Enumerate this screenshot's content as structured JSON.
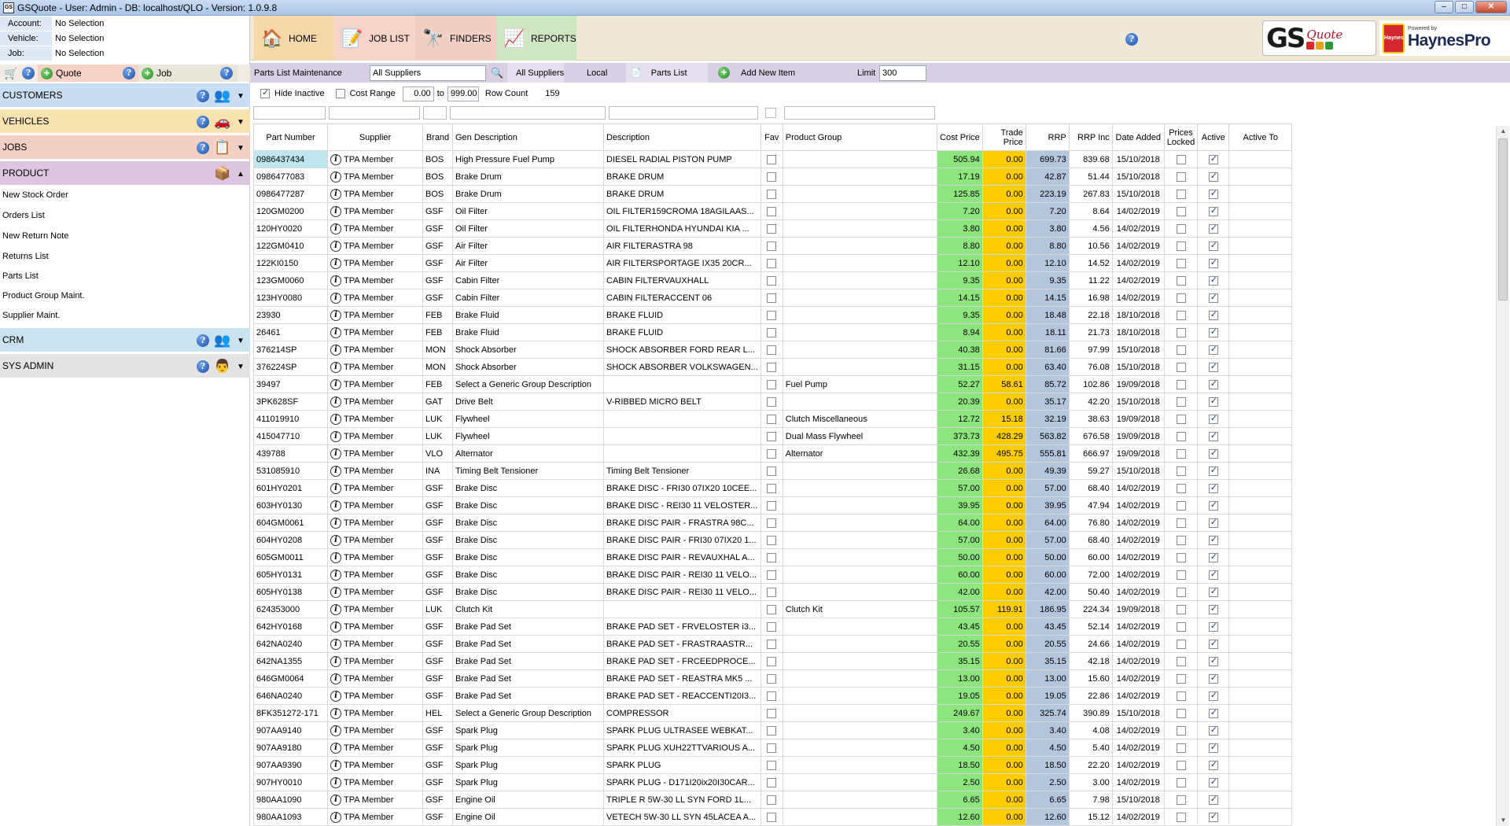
{
  "window": {
    "title": "GSQuote - User: Admin - DB: localhost/QLO - Version: 1.0.9.8",
    "app_icon": "GS"
  },
  "context": [
    {
      "label": "Account:",
      "value": "No Selection"
    },
    {
      "label": "Vehicle:",
      "value": "No Selection"
    },
    {
      "label": "Job:",
      "value": "No Selection"
    }
  ],
  "quickbar": {
    "quote_label": "Quote",
    "job_label": "Job"
  },
  "sections": {
    "customers": "CUSTOMERS",
    "vehicles": "VEHICLES",
    "jobs": "JOBS",
    "product": "PRODUCT",
    "crm": "CRM",
    "sysadmin": "SYS ADMIN"
  },
  "product_menu": [
    "New Stock Order",
    "Orders List",
    "New Return Note",
    "Returns List",
    "Parts List",
    "Product Group Maint.",
    "Supplier Maint."
  ],
  "nav": {
    "home": "HOME",
    "job_list": "JOB LIST",
    "finders": "FINDERS",
    "reports": "REPORTS"
  },
  "logos": {
    "gs": "GS",
    "quote": "Quote",
    "powered_by": "Powered by",
    "haynespro": "HaynesPro",
    "haynes_badge": "Haynes"
  },
  "toolbar": {
    "title": "Parts List Maintenance",
    "supplier_select": "All Suppliers",
    "all_suppliers": "All Suppliers",
    "local": "Local",
    "parts_list": "Parts List",
    "add_new_item": "Add New Item",
    "limit_label": "Limit",
    "limit_value": "300"
  },
  "filters": {
    "hide_inactive_label": "Hide Inactive",
    "hide_inactive_checked": true,
    "cost_range_label": "Cost Range",
    "cost_min": "0.00",
    "to_label": "to",
    "cost_max": "999.00",
    "row_count_label": "Row Count",
    "row_count": "159"
  },
  "columns": [
    "Part Number",
    "Supplier",
    "Brand",
    "Gen Description",
    "Description",
    "Fav",
    "Product Group",
    "Cost Price",
    "Trade Price",
    "RRP",
    "RRP Inc",
    "Date Added",
    "Prices Locked",
    "Active",
    "Active To"
  ],
  "rows": [
    [
      "0986437434",
      "TPA Member",
      "BOS",
      "High Pressure Fuel Pump",
      "DIESEL RADIAL PISTON PUMP",
      "",
      "505.94",
      "0.00",
      "699.73",
      "839.68",
      "15/10/2018"
    ],
    [
      "0986477083",
      "TPA Member",
      "BOS",
      "Brake Drum",
      "BRAKE DRUM",
      "",
      "17.19",
      "0.00",
      "42.87",
      "51.44",
      "15/10/2018"
    ],
    [
      "0986477287",
      "TPA Member",
      "BOS",
      "Brake Drum",
      "BRAKE DRUM",
      "",
      "125.85",
      "0.00",
      "223.19",
      "267.83",
      "15/10/2018"
    ],
    [
      "120GM0200",
      "TPA Member",
      "GSF",
      "Oil Filter",
      "OIL FILTER159CROMA 18AGILAAS...",
      "",
      "7.20",
      "0.00",
      "7.20",
      "8.64",
      "14/02/2019"
    ],
    [
      "120HY0020",
      "TPA Member",
      "GSF",
      "Oil Filter",
      "OIL FILTERHONDA HYUNDAI KIA ...",
      "",
      "3.80",
      "0.00",
      "3.80",
      "4.56",
      "14/02/2019"
    ],
    [
      "122GM0410",
      "TPA Member",
      "GSF",
      "Air Filter",
      "AIR FILTERASTRA 98",
      "",
      "8.80",
      "0.00",
      "8.80",
      "10.56",
      "14/02/2019"
    ],
    [
      "122KI0150",
      "TPA Member",
      "GSF",
      "Air Filter",
      "AIR FILTERSPORTAGE IX35 20CR...",
      "",
      "12.10",
      "0.00",
      "12.10",
      "14.52",
      "14/02/2019"
    ],
    [
      "123GM0060",
      "TPA Member",
      "GSF",
      "Cabin Filter",
      "CABIN FILTERVAUXHALL",
      "",
      "9.35",
      "0.00",
      "9.35",
      "11.22",
      "14/02/2019"
    ],
    [
      "123HY0080",
      "TPA Member",
      "GSF",
      "Cabin Filter",
      "CABIN FILTERACCENT 06",
      "",
      "14.15",
      "0.00",
      "14.15",
      "16.98",
      "14/02/2019"
    ],
    [
      "23930",
      "TPA Member",
      "FEB",
      "Brake Fluid",
      "BRAKE FLUID",
      "",
      "9.35",
      "0.00",
      "18.48",
      "22.18",
      "18/10/2018"
    ],
    [
      "26461",
      "TPA Member",
      "FEB",
      "Brake Fluid",
      "BRAKE FLUID",
      "",
      "8.94",
      "0.00",
      "18.11",
      "21.73",
      "18/10/2018"
    ],
    [
      "376214SP",
      "TPA Member",
      "MON",
      "Shock Absorber",
      "SHOCK ABSORBER FORD REAR  L...",
      "",
      "40.38",
      "0.00",
      "81.66",
      "97.99",
      "15/10/2018"
    ],
    [
      "376224SP",
      "TPA Member",
      "MON",
      "Shock Absorber",
      "SHOCK ABSORBER VOLKSWAGEN...",
      "",
      "31.15",
      "0.00",
      "63.40",
      "76.08",
      "15/10/2018"
    ],
    [
      "39497",
      "TPA Member",
      "FEB",
      "Select a Generic Group Description",
      "",
      "Fuel Pump",
      "52.27",
      "58.61",
      "85.72",
      "102.86",
      "19/09/2018"
    ],
    [
      "3PK628SF",
      "TPA Member",
      "GAT",
      "Drive Belt",
      "V-RIBBED MICRO BELT",
      "",
      "20.39",
      "0.00",
      "35.17",
      "42.20",
      "15/10/2018"
    ],
    [
      "411019910",
      "TPA Member",
      "LUK",
      "Flywheel",
      "",
      "Clutch Miscellaneous",
      "12.72",
      "15.18",
      "32.19",
      "38.63",
      "19/09/2018"
    ],
    [
      "415047710",
      "TPA Member",
      "LUK",
      "Flywheel",
      "",
      "Dual Mass Flywheel",
      "373.73",
      "428.29",
      "563.82",
      "676.58",
      "19/09/2018"
    ],
    [
      "439788",
      "TPA Member",
      "VLO",
      "Alternator",
      "",
      "Alternator",
      "432.39",
      "495.75",
      "555.81",
      "666.97",
      "19/09/2018"
    ],
    [
      "531085910",
      "TPA Member",
      "INA",
      "Timing Belt Tensioner",
      "Timing Belt Tensioner",
      "",
      "26.68",
      "0.00",
      "49.39",
      "59.27",
      "15/10/2018"
    ],
    [
      "601HY0201",
      "TPA Member",
      "GSF",
      "Brake Disc",
      "BRAKE DISC - FRI30 07IX20 10CEE...",
      "",
      "57.00",
      "0.00",
      "57.00",
      "68.40",
      "14/02/2019"
    ],
    [
      "603HY0130",
      "TPA Member",
      "GSF",
      "Brake Disc",
      "BRAKE DISC - REI30 11 VELOSTER...",
      "",
      "39.95",
      "0.00",
      "39.95",
      "47.94",
      "14/02/2019"
    ],
    [
      "604GM0061",
      "TPA Member",
      "GSF",
      "Brake Disc",
      "BRAKE DISC PAIR - FRASTRA 98C...",
      "",
      "64.00",
      "0.00",
      "64.00",
      "76.80",
      "14/02/2019"
    ],
    [
      "604HY0208",
      "TPA Member",
      "GSF",
      "Brake Disc",
      "BRAKE DISC PAIR - FRI30 07IX20 1...",
      "",
      "57.00",
      "0.00",
      "57.00",
      "68.40",
      "14/02/2019"
    ],
    [
      "605GM0011",
      "TPA Member",
      "GSF",
      "Brake Disc",
      "BRAKE DISC PAIR - REVAUXHAL A...",
      "",
      "50.00",
      "0.00",
      "50.00",
      "60.00",
      "14/02/2019"
    ],
    [
      "605HY0131",
      "TPA Member",
      "GSF",
      "Brake Disc",
      "BRAKE DISC PAIR - REI30 11 VELO...",
      "",
      "60.00",
      "0.00",
      "60.00",
      "72.00",
      "14/02/2019"
    ],
    [
      "605HY0138",
      "TPA Member",
      "GSF",
      "Brake Disc",
      "BRAKE DISC PAIR - REI30 11 VELO...",
      "",
      "42.00",
      "0.00",
      "42.00",
      "50.40",
      "14/02/2019"
    ],
    [
      "624353000",
      "TPA Member",
      "LUK",
      "Clutch Kit",
      "",
      "Clutch Kit",
      "105.57",
      "119.91",
      "186.95",
      "224.34",
      "19/09/2018"
    ],
    [
      "642HY0168",
      "TPA Member",
      "GSF",
      "Brake Pad Set",
      "BRAKE PAD SET - FRVELOSTER i3...",
      "",
      "43.45",
      "0.00",
      "43.45",
      "52.14",
      "14/02/2019"
    ],
    [
      "642NA0240",
      "TPA Member",
      "GSF",
      "Brake Pad Set",
      "BRAKE PAD SET - FRASTRAASTR...",
      "",
      "20.55",
      "0.00",
      "20.55",
      "24.66",
      "14/02/2019"
    ],
    [
      "642NA1355",
      "TPA Member",
      "GSF",
      "Brake Pad Set",
      "BRAKE PAD SET - FRCEEDPROCE...",
      "",
      "35.15",
      "0.00",
      "35.15",
      "42.18",
      "14/02/2019"
    ],
    [
      "646GM0064",
      "TPA Member",
      "GSF",
      "Brake Pad Set",
      "BRAKE PAD SET - REASTRA MK5 ...",
      "",
      "13.00",
      "0.00",
      "13.00",
      "15.60",
      "14/02/2019"
    ],
    [
      "646NA0240",
      "TPA Member",
      "GSF",
      "Brake Pad Set",
      "BRAKE PAD SET - REACCENTI20I3...",
      "",
      "19.05",
      "0.00",
      "19.05",
      "22.86",
      "14/02/2019"
    ],
    [
      "8FK351272-171",
      "TPA Member",
      "HEL",
      "Select a Generic Group Description",
      "COMPRESSOR",
      "",
      "249.67",
      "0.00",
      "325.74",
      "390.89",
      "15/10/2018"
    ],
    [
      "907AA9140",
      "TPA Member",
      "GSF",
      "Spark Plug",
      "SPARK PLUG ULTRASEE WEBKAT...",
      "",
      "3.40",
      "0.00",
      "3.40",
      "4.08",
      "14/02/2019"
    ],
    [
      "907AA9180",
      "TPA Member",
      "GSF",
      "Spark Plug",
      "SPARK PLUG XUH22TTVARIOUS A...",
      "",
      "4.50",
      "0.00",
      "4.50",
      "5.40",
      "14/02/2019"
    ],
    [
      "907AA9390",
      "TPA Member",
      "GSF",
      "Spark Plug",
      "SPARK PLUG",
      "",
      "18.50",
      "0.00",
      "18.50",
      "22.20",
      "14/02/2019"
    ],
    [
      "907HY0010",
      "TPA Member",
      "GSF",
      "Spark Plug",
      "SPARK PLUG - D171I20ix20I30CAR...",
      "",
      "2.50",
      "0.00",
      "2.50",
      "3.00",
      "14/02/2019"
    ],
    [
      "980AA1090",
      "TPA Member",
      "GSF",
      "Engine Oil",
      "TRIPLE R 5W-30 LL SYN FORD 1L...",
      "",
      "6.65",
      "0.00",
      "6.65",
      "7.98",
      "15/10/2018"
    ],
    [
      "980AA1093",
      "TPA Member",
      "GSF",
      "Engine Oil",
      "VETECH 5W-30 LL SYN 45LACEA A...",
      "",
      "12.60",
      "0.00",
      "12.60",
      "15.12",
      "14/02/2019"
    ]
  ],
  "colors": {
    "cost": "#8fe57d",
    "trade": "#ffcc00",
    "rrp": "#b3c6dc",
    "selected": "#bfe6f0"
  }
}
